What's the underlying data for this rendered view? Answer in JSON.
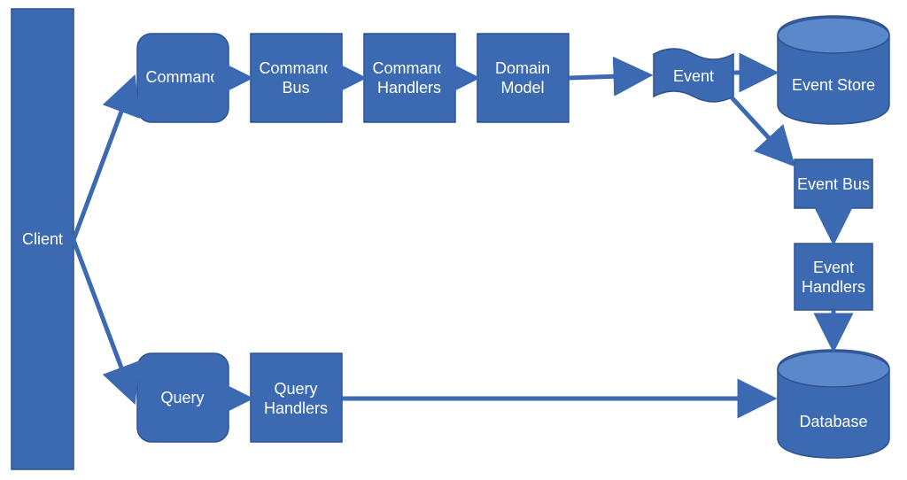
{
  "colors": {
    "fill": "#3B69B2",
    "stroke": "#2F528F",
    "top": "#5B87CB"
  },
  "nodes": {
    "client": "Client",
    "command": "Command",
    "command_bus_l1": "Command",
    "command_bus_l2": "Bus",
    "command_handlers_l1": "Command",
    "command_handlers_l2": "Handlers",
    "domain_model_l1": "Domain",
    "domain_model_l2": "Model",
    "event": "Event",
    "event_store": "Event Store",
    "event_bus": "Event Bus",
    "event_handlers_l1": "Event",
    "event_handlers_l2": "Handlers",
    "query": "Query",
    "query_handlers_l1": "Query",
    "query_handlers_l2": "Handlers",
    "database": "Database"
  }
}
